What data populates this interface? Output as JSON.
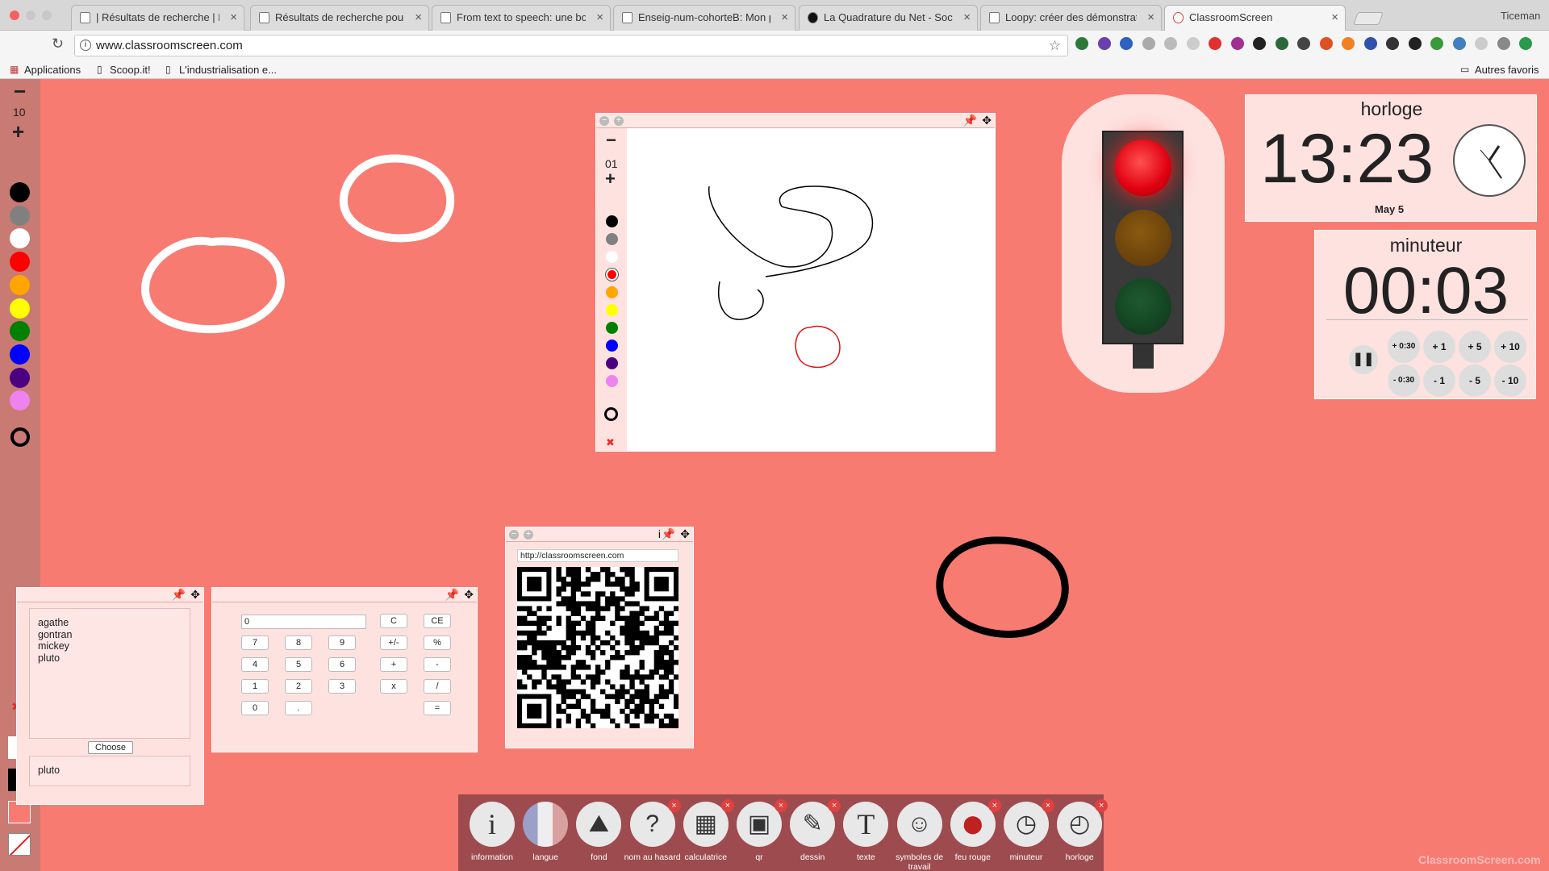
{
  "browser": {
    "tabs": [
      {
        "title": "| Résultats de recherche | Le p"
      },
      {
        "title": "Résultats de recherche pour «"
      },
      {
        "title": "From text to speech: une bonn"
      },
      {
        "title": "Enseig-num-cohorteB: Mon p"
      },
      {
        "title": "La Quadrature du Net - Social"
      },
      {
        "title": "Loopy: créer des démonstratio"
      },
      {
        "title": "ClassroomScreen"
      }
    ],
    "user": "Ticeman",
    "url": "www.classroomscreen.com",
    "bookmarks": [
      "Applications",
      "Scoop.it!",
      "L'industrialisation e..."
    ],
    "other_bookmarks": "Autres favoris"
  },
  "left_toolbar": {
    "minus": "−",
    "size": "10",
    "plus": "+",
    "colors": [
      "#000000",
      "#808080",
      "#ffffff",
      "#ff0000",
      "#ffa500",
      "#ffff00",
      "#008000",
      "#0000ff",
      "#4b0082",
      "#ee82ee"
    ]
  },
  "drawing_widget": {
    "minus": "−",
    "size": "01",
    "plus": "+",
    "colors": [
      "#000000",
      "#808080",
      "#ffffff",
      "#ff0000",
      "#ffa500",
      "#ffff00",
      "#008000",
      "#0000ff",
      "#4b0082",
      "#ee82ee"
    ],
    "clear": "✖"
  },
  "clock": {
    "title": "horloge",
    "time": "13:23",
    "date": "May 5"
  },
  "timer": {
    "title": "minuteur",
    "time": "00:03",
    "buttons_top": [
      "+ 0:30",
      "+ 1",
      "+ 5",
      "+ 10"
    ],
    "buttons_bottom": [
      "- 0:30",
      "- 1",
      "- 5",
      "- 10"
    ]
  },
  "name_picker": {
    "names": [
      "agathe",
      "gontran",
      "mickey",
      "pluto"
    ],
    "choose_label": "Choose",
    "result": "pluto"
  },
  "calculator": {
    "display": "0",
    "keys": [
      [
        "C",
        "CE"
      ],
      [
        "7",
        "8",
        "9",
        "+/-",
        "%"
      ],
      [
        "4",
        "5",
        "6",
        "+",
        "-"
      ],
      [
        "1",
        "2",
        "3",
        "x",
        "/"
      ],
      [
        "0",
        ".",
        "="
      ]
    ]
  },
  "qr": {
    "info": "i",
    "url": "http://classroomscreen.com"
  },
  "dock": {
    "items": [
      {
        "label": "information",
        "icon": "info-icon",
        "glyph": "i",
        "closable": false
      },
      {
        "label": "langue",
        "icon": "flag-icon",
        "glyph": "",
        "closable": false
      },
      {
        "label": "fond",
        "icon": "landscape-icon",
        "glyph": "⛰",
        "closable": false
      },
      {
        "label": "nom au hasard",
        "icon": "random-name-icon",
        "glyph": "?",
        "closable": true
      },
      {
        "label": "calculatrice",
        "icon": "calculator-icon",
        "glyph": "▦",
        "closable": true
      },
      {
        "label": "qr",
        "icon": "qr-icon",
        "glyph": "▣",
        "closable": true
      },
      {
        "label": "dessin",
        "icon": "pencil-icon",
        "glyph": "✎",
        "closable": true
      },
      {
        "label": "texte",
        "icon": "text-icon",
        "glyph": "T",
        "closable": false
      },
      {
        "label": "symboles de travail",
        "icon": "work-symbols-icon",
        "glyph": "☺",
        "closable": false
      },
      {
        "label": "feu rouge",
        "icon": "traffic-light-icon",
        "glyph": "⬤",
        "closable": true
      },
      {
        "label": "minuteur",
        "icon": "timer-icon",
        "glyph": "◷",
        "closable": true
      },
      {
        "label": "horloge",
        "icon": "clock-icon",
        "glyph": "◴",
        "closable": true
      }
    ]
  },
  "watermark": "ClassroomScreen.com"
}
